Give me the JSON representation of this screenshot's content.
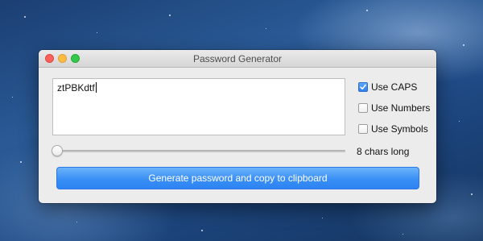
{
  "window": {
    "title": "Password Generator"
  },
  "password": {
    "value": "ztPBKdtf"
  },
  "options": [
    {
      "label": "Use CAPS",
      "checked": true
    },
    {
      "label": "Use Numbers",
      "checked": false
    },
    {
      "label": "Use Symbols",
      "checked": false
    }
  ],
  "length": {
    "label": "8 chars long",
    "slider_fraction": 0.0
  },
  "actions": {
    "generate_label": "Generate password and copy to clipboard"
  },
  "colors": {
    "accent": "#3a8ff5",
    "close": "#fc605c",
    "minimize": "#fdbc40",
    "zoom": "#34c84a"
  },
  "icons": {
    "checkbox_checked": "checkmark-icon"
  }
}
